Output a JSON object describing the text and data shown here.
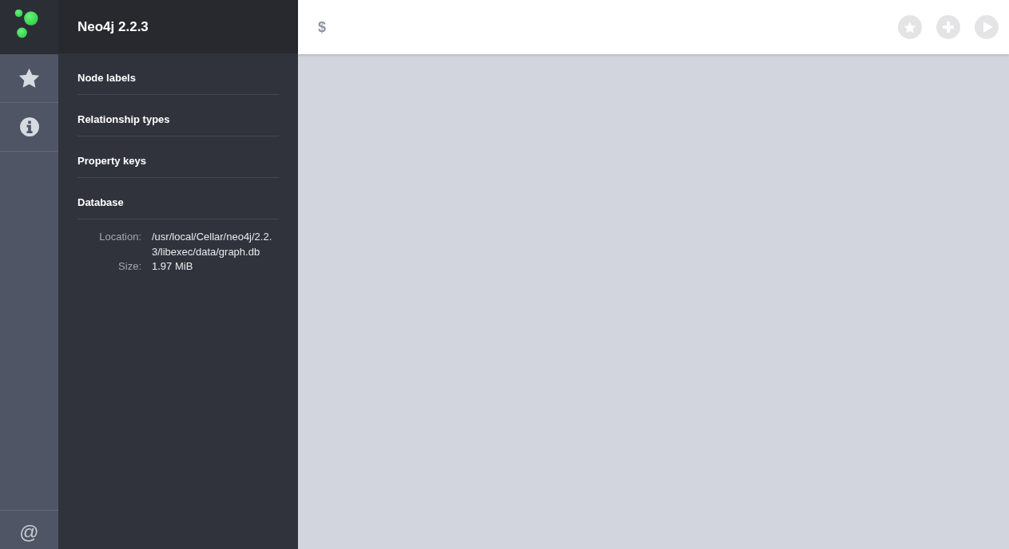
{
  "sidebar": {
    "title": "Neo4j 2.2.3",
    "sections": [
      {
        "label": "Node labels"
      },
      {
        "label": "Relationship types"
      },
      {
        "label": "Property keys"
      },
      {
        "label": "Database"
      }
    ],
    "database_info": [
      {
        "label": "Location:",
        "value": "/usr/local/Cellar/neo4j/2.2.3/libexec/data/graph.db"
      },
      {
        "label": "Size:",
        "value": "1.97 MiB"
      }
    ]
  },
  "nav_footer": {
    "symbol": "@"
  },
  "editor": {
    "prompt": "$"
  }
}
